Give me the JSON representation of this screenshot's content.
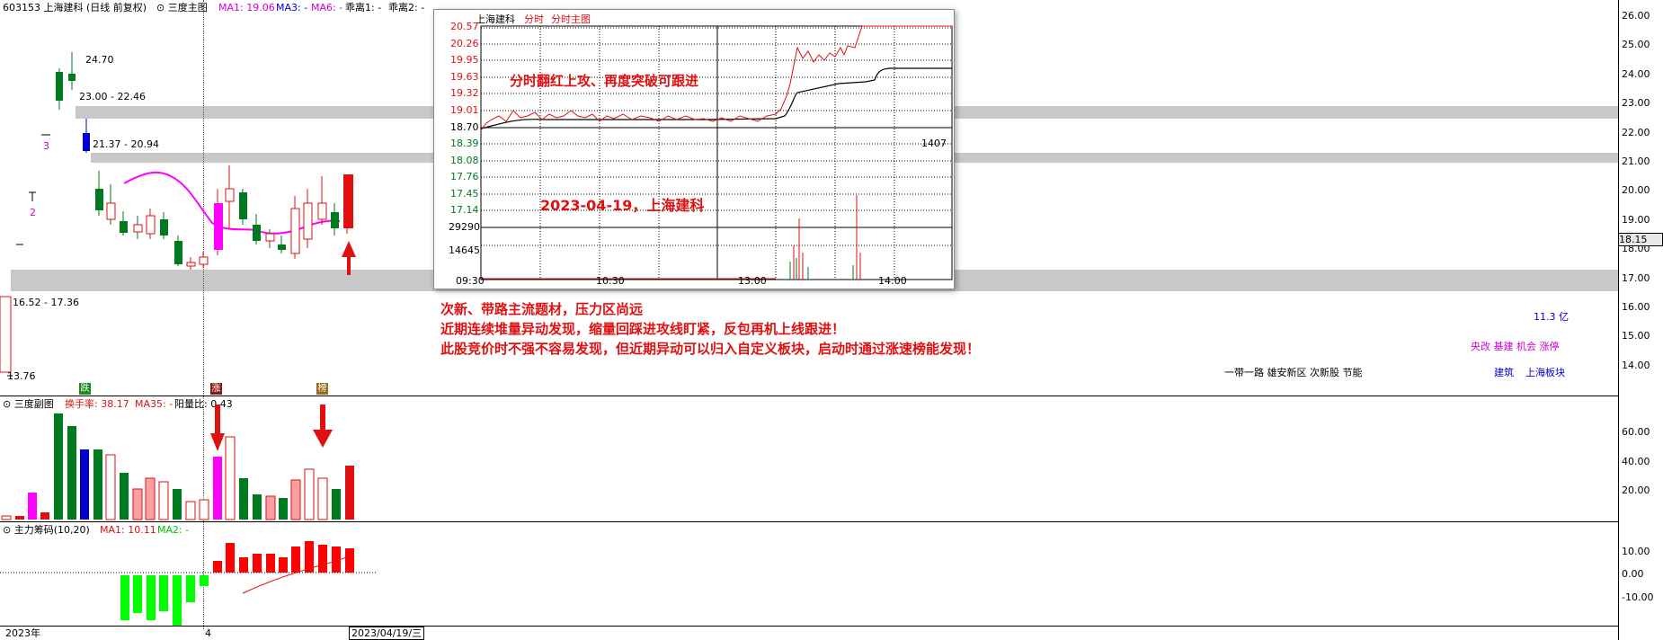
{
  "header": {
    "code_name": "603153 上海建科 (日线 前复权)",
    "main_chart_label": "三度主图",
    "ma1": "MA1: 19.06",
    "ma3": "MA3: -",
    "ma6": "MA6: -",
    "fl1": "乖离1: -",
    "fl2": "乖离2: -"
  },
  "price_axis": [
    "26.00",
    "25.00",
    "24.00",
    "23.00",
    "22.00",
    "21.00",
    "20.00",
    "19.00",
    "18.00",
    "17.00",
    "16.00",
    "15.00",
    "14.00"
  ],
  "current_price": "18.15",
  "main_labels": {
    "high_24": "24.70",
    "zone_1": "23.00 - 22.46",
    "zone_2": "21.37 - 20.94",
    "zone_3": "16.52 - 17.36",
    "low_val": "13.76",
    "n3": "3",
    "n2": "2"
  },
  "markers": {
    "die": "跌",
    "zhang": "涨",
    "bang": "榜"
  },
  "annotations": {
    "line1": "次新、带路主流题材，压力区尚远",
    "line2": "近期连续堆量异动发现，缩量回踩进攻线盯紧，反包再机上线跟进！",
    "line3": "此股竞价时不强不容易发现，但近期异动可以归入自定义板块，启动时通过涨速榜能发现！"
  },
  "info": {
    "market_cap": "11.3 亿",
    "tags": "央改 基建 机会 涨停",
    "concepts": "一带一路 雄安新区 次新股 节能",
    "sector1": "建筑",
    "sector2": "上海板块"
  },
  "sub1": {
    "title": "三度副图",
    "turnover": "换手率: 38.17",
    "ma35": "MA35: -",
    "yang": "阳量比: 0.43",
    "axis": [
      "60.00",
      "40.00",
      "20.00"
    ]
  },
  "sub2": {
    "title": "主力筹码(10,20)",
    "ma1": "MA1: 10.11",
    "ma2": "MA2: -",
    "axis": [
      "10.00",
      "0.00",
      "-10.00"
    ]
  },
  "time_bar": {
    "year": "2023年",
    "month": "4",
    "date": "2023/04/19/三",
    "period": "日线"
  },
  "popup": {
    "stock": "上海建科",
    "tab1": "分时",
    "tab2": "分时主图",
    "price_up": [
      "20.57",
      "20.26",
      "19.95",
      "19.63",
      "19.32",
      "19.01"
    ],
    "base": "18.70",
    "price_down": [
      "18.39",
      "18.08",
      "17.76",
      "17.45",
      "17.14"
    ],
    "vol_top": "29290",
    "vol_mid": "14645",
    "vol_tag": "1407",
    "times": [
      "09:30",
      "10:30",
      "13:00",
      "14:00"
    ],
    "note1": "分时翻红上攻、再度突破可跟进",
    "note2": "2023-04-19，上海建科"
  },
  "colors": {
    "up": "#e01010",
    "down": "#007a1e",
    "ma": "#ff00ff",
    "band": "#c8c8c8",
    "chip_pos": "#ff0000",
    "chip_neg": "#00ff00"
  }
}
